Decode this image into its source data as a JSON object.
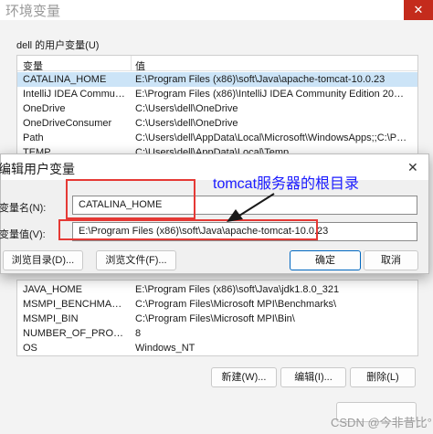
{
  "env_window": {
    "title": "环境变量",
    "close_glyph": "✕",
    "user_group_label": "dell 的用户变量(U)",
    "list_headers": {
      "variable": "变量",
      "value": "值"
    },
    "user_vars": [
      {
        "name": "CATALINA_HOME",
        "value": "E:\\Program Files (x86)\\soft\\Java\\apache-tomcat-10.0.23",
        "selected": true
      },
      {
        "name": "IntelliJ IDEA Community E...",
        "value": "E:\\Program Files (x86)\\IntelliJ IDEA Community Edition 2022.1..."
      },
      {
        "name": "OneDrive",
        "value": "C:\\Users\\dell\\OneDrive"
      },
      {
        "name": "OneDriveConsumer",
        "value": "C:\\Users\\dell\\OneDrive"
      },
      {
        "name": "Path",
        "value": "C:\\Users\\dell\\AppData\\Local\\Microsoft\\WindowsApps;;C:\\Pro..."
      },
      {
        "name": "TEMP",
        "value": "C:\\Users\\dell\\AppData\\Local\\Temp"
      }
    ],
    "system_vars": [
      {
        "name": "JAVA_HOME",
        "value": "E:\\Program Files (x86)\\soft\\Java\\jdk1.8.0_321"
      },
      {
        "name": "MSMPI_BENCHMARKS",
        "value": "C:\\Program Files\\Microsoft MPI\\Benchmarks\\"
      },
      {
        "name": "MSMPI_BIN",
        "value": "C:\\Program Files\\Microsoft MPI\\Bin\\"
      },
      {
        "name": "NUMBER_OF_PROCESSORS",
        "value": "8"
      },
      {
        "name": "OS",
        "value": "Windows_NT"
      }
    ],
    "buttons": {
      "new": "新建(W)...",
      "edit": "编辑(I)...",
      "delete": "删除(L)"
    }
  },
  "edit_dialog": {
    "title": "编辑用户变量",
    "close_glyph": "✕",
    "name_label": "变量名(N):",
    "value_label": "变量值(V):",
    "name_value": "CATALINA_HOME",
    "value_value": "E:\\Program Files (x86)\\soft\\Java\\apache-tomcat-10.0.23",
    "buttons": {
      "browse_dir": "浏览目录(D)...",
      "browse_file": "浏览文件(F)...",
      "ok": "确定",
      "cancel": "取消"
    }
  },
  "annotation": {
    "text": "tomcat服务器的根目录",
    "color": "#1a1aff",
    "box_color": "#e53935"
  },
  "watermark": "CSDN @今非昔比°"
}
